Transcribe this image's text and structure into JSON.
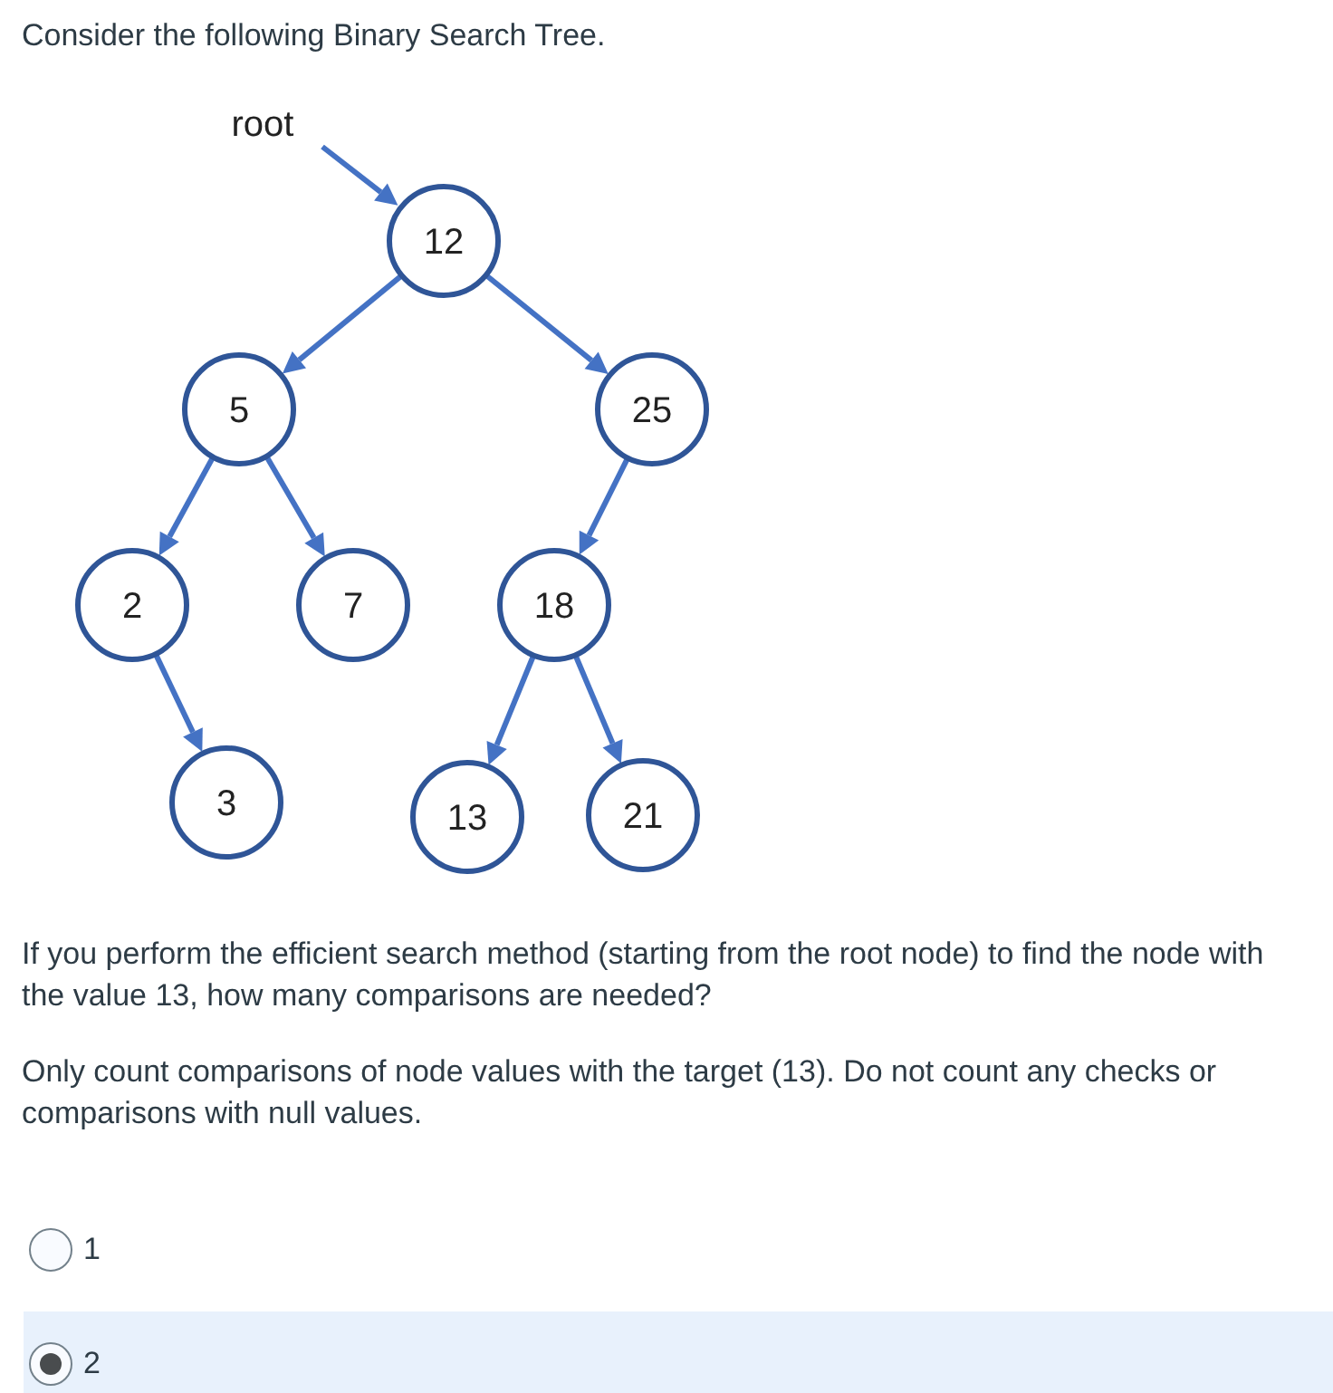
{
  "prompt": "Consider the following Binary Search Tree.",
  "diagram": {
    "root_label": "root",
    "tree": {
      "value": "12",
      "children": [
        {
          "value": "5",
          "children": [
            {
              "value": "2",
              "children": [
                {
                  "value": "3"
                }
              ]
            },
            {
              "value": "7"
            }
          ]
        },
        {
          "value": "25",
          "children": [
            {
              "value": "18",
              "children": [
                {
                  "value": "13"
                },
                {
                  "value": "21"
                }
              ]
            }
          ]
        }
      ]
    }
  },
  "question": "If you perform the efficient search method (starting from the root node) to find the node with the value 13, how many comparisons are needed?",
  "note": "Only count comparisons of node values with the target (13). Do not count any checks or comparisons with null values.",
  "options": [
    {
      "label": "1",
      "selected": false
    },
    {
      "label": "2",
      "selected": true
    }
  ]
}
